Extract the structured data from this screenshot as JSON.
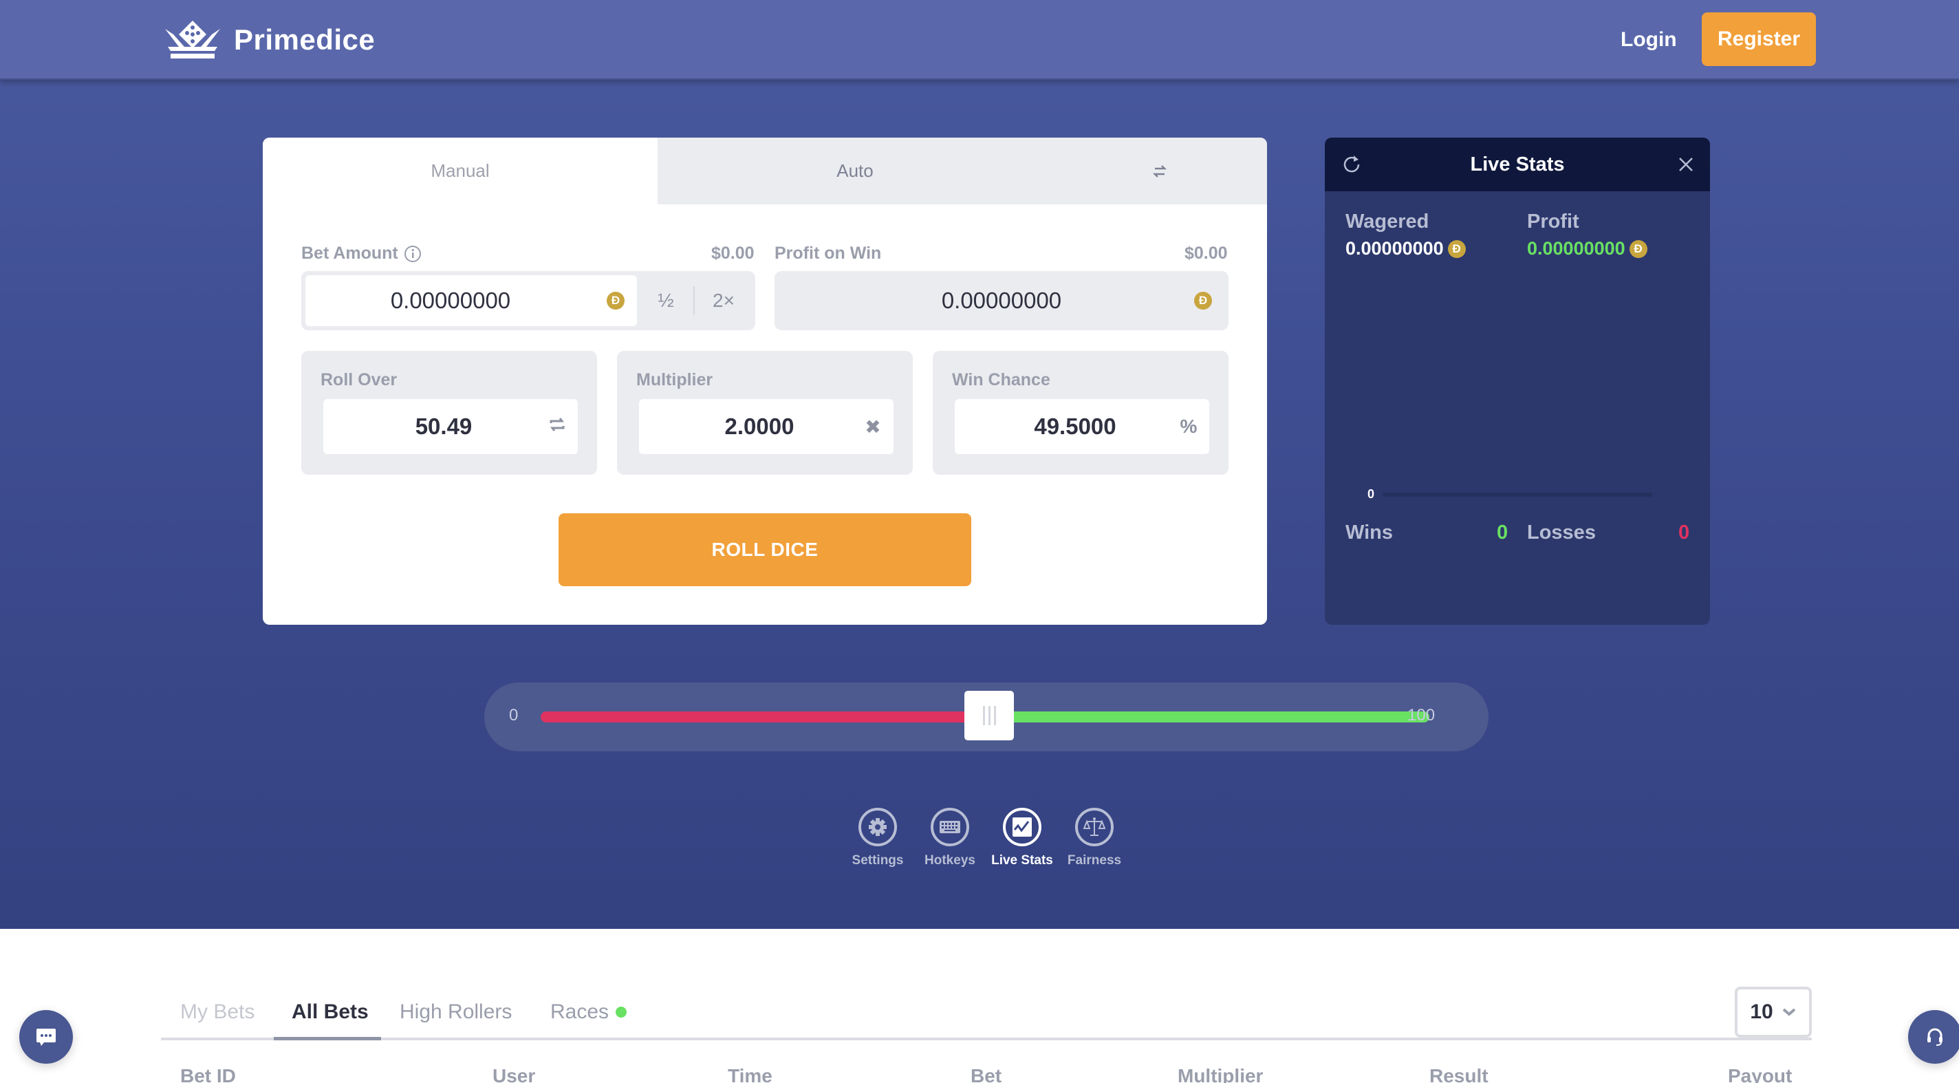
{
  "header": {
    "brand": "Primedice",
    "login_label": "Login",
    "register_label": "Register"
  },
  "bet_panel": {
    "tabs": [
      {
        "label": "Manual",
        "active": true
      },
      {
        "label": "Auto",
        "active": false
      }
    ],
    "swap_icon": "swap-arrows-icon",
    "bet_amount": {
      "label": "Bet Amount",
      "usd": "$0.00",
      "value": "0.00000000",
      "currency_symbol": "Ð",
      "half_label": "½",
      "double_label": "2×"
    },
    "profit_on_win": {
      "label": "Profit on Win",
      "usd": "$0.00",
      "value": "0.00000000",
      "currency_symbol": "Ð"
    },
    "roll_over": {
      "label": "Roll Over",
      "value": "50.49",
      "icon": "swap-icon"
    },
    "multiplier": {
      "label": "Multiplier",
      "value": "2.0000",
      "suffix": "✖"
    },
    "win_chance": {
      "label": "Win Chance",
      "value": "49.5000",
      "suffix": "%"
    },
    "roll_button": "ROLL DICE"
  },
  "live_stats": {
    "title": "Live Stats",
    "wagered_label": "Wagered",
    "wagered_value": "0.00000000",
    "profit_label": "Profit",
    "profit_value": "0.00000000",
    "currency_symbol": "Ð",
    "chart_zero": "0",
    "wins_label": "Wins",
    "wins_value": "0",
    "losses_label": "Losses",
    "losses_value": "0",
    "colors": {
      "profit": "#69e163",
      "wins": "#69e163",
      "losses": "#df3261"
    }
  },
  "slider": {
    "min_label": "0",
    "max_label": "100",
    "value": 50.49,
    "min": 0,
    "max": 100,
    "lose_color": "#df3261",
    "win_color": "#69e163"
  },
  "tools": [
    {
      "label": "Settings",
      "icon": "gear-icon",
      "active": false
    },
    {
      "label": "Hotkeys",
      "icon": "keyboard-icon",
      "active": false
    },
    {
      "label": "Live Stats",
      "icon": "chart-icon",
      "active": true
    },
    {
      "label": "Fairness",
      "icon": "scales-icon",
      "active": false
    }
  ],
  "bets": {
    "tabs": [
      {
        "label": "My Bets",
        "state": "muted"
      },
      {
        "label": "All Bets",
        "state": "active"
      },
      {
        "label": "High Rollers",
        "state": "normal"
      },
      {
        "label": "Races",
        "state": "normal",
        "live_dot": true
      }
    ],
    "per_page": "10",
    "columns": [
      "Bet ID",
      "User",
      "Time",
      "Bet",
      "Multiplier",
      "Result",
      "Payout"
    ]
  },
  "accent_color": "#f2a03a"
}
